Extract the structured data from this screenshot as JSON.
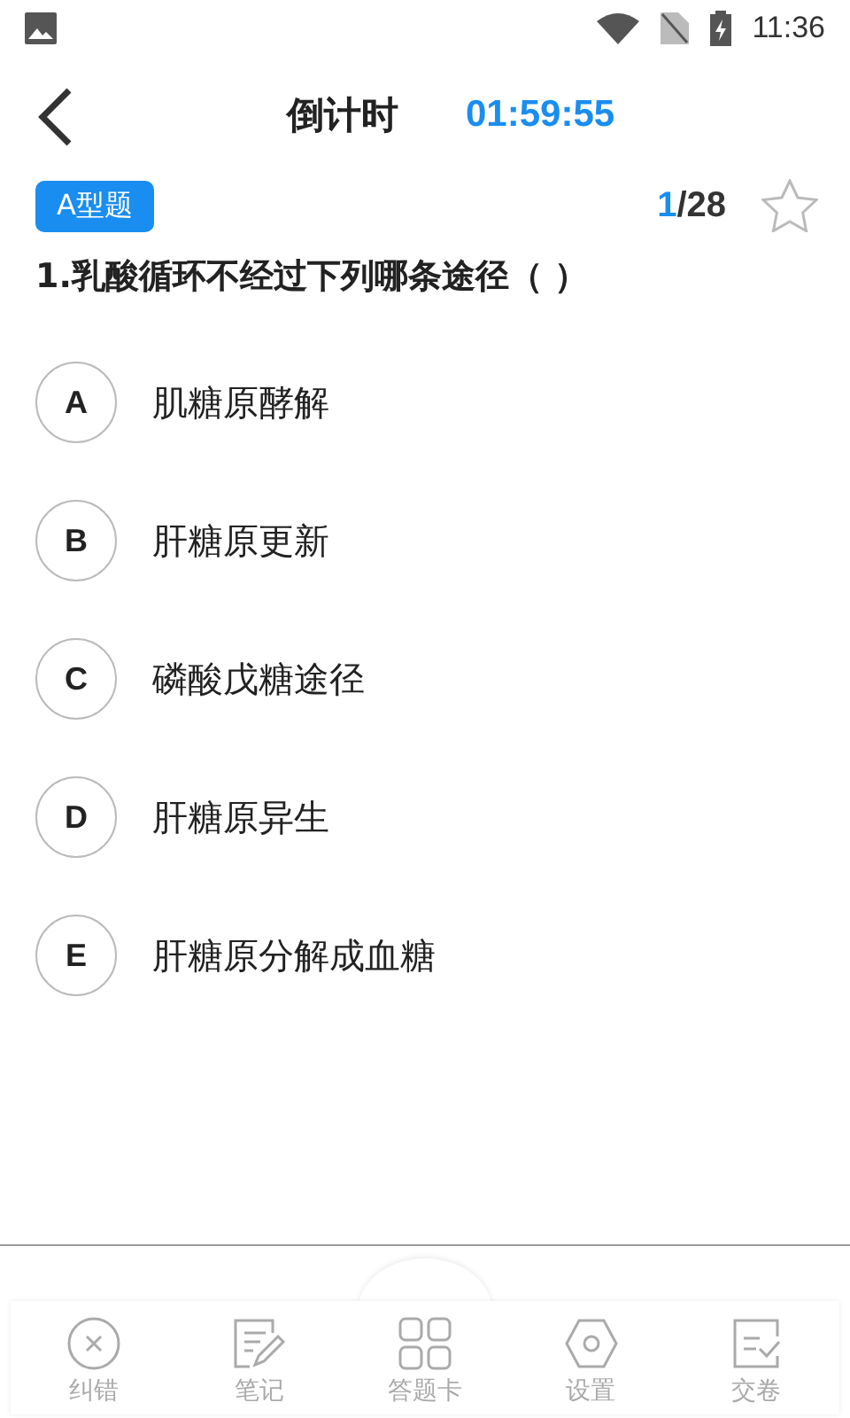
{
  "status_bar": {
    "time": "11:36"
  },
  "header": {
    "title": "倒计时",
    "countdown": "01:59:55"
  },
  "question_bar": {
    "type_tag": "A型题",
    "current": "1",
    "total": "/28",
    "starred": false
  },
  "question": {
    "text": "1.乳酸循环不经过下列哪条途径（  ）",
    "options": [
      {
        "letter": "A",
        "text": "肌糖原酵解",
        "selected": false
      },
      {
        "letter": "B",
        "text": "肝糖原更新",
        "selected": false
      },
      {
        "letter": "C",
        "text": "磷酸戊糖途径",
        "selected": false
      },
      {
        "letter": "D",
        "text": "肝糖原异生",
        "selected": false
      },
      {
        "letter": "E",
        "text": "肝糖原分解成血糖",
        "selected": false
      }
    ]
  },
  "bottom_nav": [
    {
      "kind": "error",
      "label": "纠错"
    },
    {
      "kind": "note",
      "label": "笔记"
    },
    {
      "kind": "card",
      "label": "答题卡"
    },
    {
      "kind": "settings",
      "label": "设置"
    },
    {
      "kind": "submit",
      "label": "交卷"
    }
  ]
}
